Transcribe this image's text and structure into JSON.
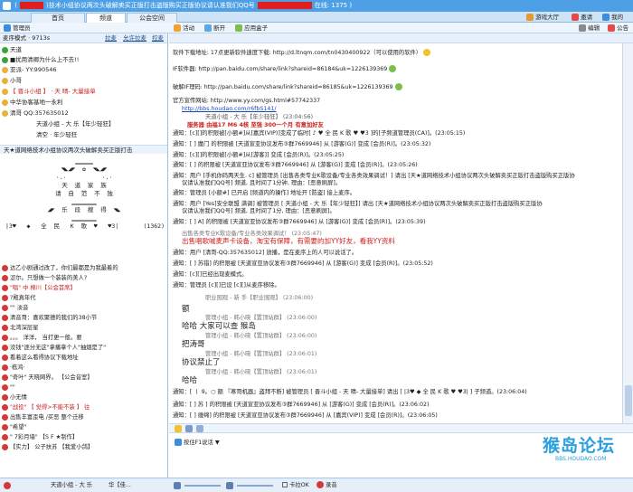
{
  "window": {
    "title_pre": "(",
    "title_mid": ")技术小组协议两次头破解卖买正版打击盗版购买正版协议请认准我们QQ号",
    "title_post": "在线: 1375 )"
  },
  "tabs": {
    "home": "首页",
    "channel": "频道",
    "square": "公会空间"
  },
  "right_tools": {
    "game": "游戏大厅",
    "invite": "邀请",
    "me": "我的"
  },
  "top": {
    "admin": "管理员",
    "activity": "活动",
    "disconnect": "断开",
    "apps": "应用盒子",
    "edit": "编辑",
    "notice": "公告"
  },
  "left": {
    "mic_mode": "麦序模式 · 9713s",
    "mic_links": [
      "拉麦",
      "允许拉麦",
      "控麦"
    ],
    "users_top": [
      "天道",
      "■扰用清卿为什么上不去!!",
      "亚派- YY:990546",
      "小哥",
      "【 晋斗小组 】 · 天  晴- 大量接单",
      "中华协客基地一永利",
      "清哥 QQ:357635012",
      "天道小组 - 大  乐【年少轻狂】",
      "清空 · 年少轻狂"
    ],
    "channel_title": "天★道网络技术小组协议两次头破解卖买正版打击",
    "art": [
      "▁▁▁▁▁",
      "◥◣◢◤  ✿  ◥◣◢◤",
      "·.·          ·.·",
      "天  道  家  族",
      "请  自  范  不  独",
      "▁▁▁▁▁▁▁",
      "◢◤  乐  段  搜  得  ◥◣",
      "▁▁▁▁▁▁▁",
      "|3♥   ◆   全  民   K  歌  ♥   ♥3|"
    ],
    "chan_count": "(1362)",
    "users": [
      "达乙小剧通过改了，你们最都是为我最着的",
      "涩尔。只想做一个装装的美人?",
      "\"唱\" 中    棉川【公会首席】",
      "?殿真年代",
      "\"\" 淡音",
      "清音哥：喜欢聚德的我们的38小节",
      "北湾深层星",
      "。。。 洋洋，  当打更一般。要",
      "没钱\"逐分无这\"拿播拿个人\"抽烟是了\"",
      "看着这么看得协议下载地址",
      "·栋鸿·",
      "\"奇叶\"   天晓网界。  【公会音室】",
      "\"\"",
      "小无情",
      "\"战役\"  【 觉得>不能不装 】  往",
      "出售丰富歪电 /买恶   整个迁移",
      "\"希望\"",
      "\"  7彩月墙\"   【S F ★制作】",
      "【实力】   公子扶苏  【我爱小鸽】"
    ]
  },
  "messages": [
    {
      "text": "软件下载地址: 17点更新软件速度下载: http://d.ltnqm.com/tn0430400922（可以使用的软件）",
      "link": "http://d.ltnqm.com/tn0430400922"
    },
    {
      "text": "IF软件器: http://pan.baidu.com/share/link?shareid=86184&uk=1226139369",
      "link": "http://pan.baidu.com/share/link?shareid=86184&uk=1226139369"
    },
    {
      "text": "破解IF理码: http://pan.baidu.com/share/link?shareid=86185&uk=1226139369",
      "link": "http://pan.baidu.com/share/link?shareid=86185&uk=1226139369"
    },
    {
      "text": "官方宣传网站: http://www.yy.com/gs.html#57742337"
    },
    {
      "text": "http://bbs.houdao.com/r6fbS141/"
    },
    {
      "text": "天道小组 - 大  乐【年少轻狂】  (23:04:56)"
    },
    {
      "text": "服务器  由福17 M6  4核  至强  300一个月  有意加好友"
    },
    {
      "text": "通知：[c][]的积限被[小额#]从[嘉宾(VIP)]变成了临时[  ♪ ♥  全 民  K 歌  ♥  ♥3 ]的[子频道管理员(CA)]。(23:05:15)"
    },
    {
      "text": "通知：[                          ] 魔门 的积限被 [天道宣亚协议发布③群7669946] 从 [游客(G)] 变成 [会员(R)]。(23:05:32)"
    },
    {
      "text": "通知：[c][]的积限被[小额#]从[游客]] 变成 [会员(R)]。(23:05:25)"
    },
    {
      "text": "通知：[                          ] 的积限被 [天道宣亚协议发布③群7669946] 从 [游客(G)] 变成 [会员(R)]。(23:05:26)"
    },
    {
      "text": "通知：用户 [手机你码两天生. c] 被管理员 [出售各类专业K歌设备/专业各类效果调试！] 请出 [天★道网络技术小组协议两次头破解卖买正版打击盗版购买正版协"
    },
    {
      "text": "议请认准我们QQ号] 频道, 且时间了1分钟, 理由：[恶意刷屏]。"
    },
    {
      "text": "通知：管理员 [小额#] 已开启 [频道内的操作] 地址开 [防盗] 接上麦序。"
    },
    {
      "text": "通知：用户 [Yes]安全联盟 满调] 被管理员 [        天道小组 - 大  乐【年少轻狂】] 请出 [天★道网络技术小组协议两次头破解卖买正版打击盗版购买正版协"
    },
    {
      "text": "议请认准我们QQ号] 频道, 且时间了1分, 理由：[恶意刷屏]。"
    },
    {
      "text": "通知：[                          ] A] 的积限被 [天道宣亚协议发布③群7669946] 从 [游客(G)] 变成 [会员(R)]。(23:05:39)"
    },
    {
      "text": "出售各类专业K歌设备/专业各类效果调试！  (23:05:47)"
    },
    {
      "text": "出售唱歌喊麦声卡设备，淘宝有保障，有需要的加YY好友，看我YY资料"
    },
    {
      "text": "通知：用户 [清哥-QQ:357635012] 放播，是在麦序上的人可以说话了。"
    },
    {
      "text": "通知：[                          ] 苏错] 的积限被 [天道宣亚协议发布③群7669946] 从 [游客(G)] 变成 [会员(R)]。(23:05:52)"
    },
    {
      "text": "通知：[c][]已经出现麦模式。"
    },
    {
      "text": "通知：管理员 [c][]已设 [c][]从麦序移除。"
    },
    {
      "text": "职业围观 - 新  手【职业围观】  (23:06:00)"
    },
    {
      "text": "额"
    },
    {
      "text": "管理小组 - 韩小晓【置顶站群】  (23:06:00)"
    },
    {
      "text": "哈哈  大家可以查  猴岛"
    },
    {
      "text": "管理小组 - 韩小晓【置顶站群】  (23:06:00)"
    },
    {
      "text": "把涛哥"
    },
    {
      "text": "管理小组 - 韩小晓【置顶站群】  (23:06:01)"
    },
    {
      "text": "协议禁止了"
    },
    {
      "text": "管理小组 - 韩小晓【置顶站群】  (23:06:01)"
    },
    {
      "text": "哈哈"
    },
    {
      "text": "通知：[ 丨 9。○ 额 『寒哥机器』盗拜不断] 被管理员 [      晋斗小组 - 天  晴- 大量接单] 请出 [ |3♥   ◆ 全  民  K 歌   ♥  ♥3| ] 子频道。(23:06:04)"
    },
    {
      "text": "通知：[                          ] 苏 ] 的积限被 [天道宣亚协议发布③群7669946] 从 [游客(G)] 变成 [会员(R)]。(23:06:02)"
    },
    {
      "text": "通知：[                          ] 缠绵] 的积限被 [天道宣亚协议发布③群7669946] 从 [嘉宾(VIP)] 变成 [会员(R)]。(23:06:05)"
    }
  ],
  "input": {
    "mode_label": "按住F1说话",
    "mode_caret": "▼"
  },
  "bottom": {
    "name": "天道小组 - 大  乐",
    "tag": "华【佳...",
    "mic_label": "卡拉OK",
    "record_label": "录音"
  },
  "logo": {
    "text": "猴岛论坛",
    "sub": "BBS.HOUDAO.COM"
  },
  "colors": {
    "accent": "#4ea0e6",
    "red": "#d21e1e",
    "link": "#1b4bba"
  }
}
